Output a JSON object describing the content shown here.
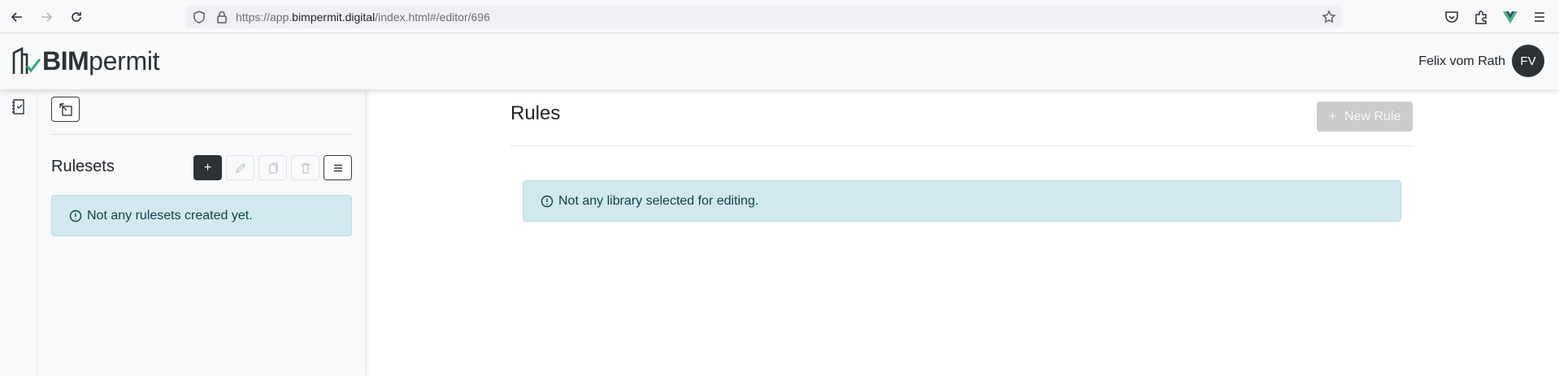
{
  "browser": {
    "url_prefix": "https://app.",
    "url_domain": "bimpermit.digital",
    "url_path": "/index.html#/editor/696"
  },
  "header": {
    "logo_bold": "BIM",
    "logo_light": "permit",
    "user_name": "Felix vom Rath",
    "avatar_initials": "FV"
  },
  "sidebar": {
    "title": "Rulesets",
    "add_label": "+",
    "empty_message": "Not any rulesets created yet."
  },
  "main": {
    "title": "Rules",
    "new_rule_label": "New Rule",
    "new_rule_icon": "+",
    "empty_message": "Not any library selected for editing."
  },
  "colors": {
    "accent_dark": "#2d3235",
    "alert_bg": "#d1e9ee",
    "logo_check": "#2aa876"
  }
}
